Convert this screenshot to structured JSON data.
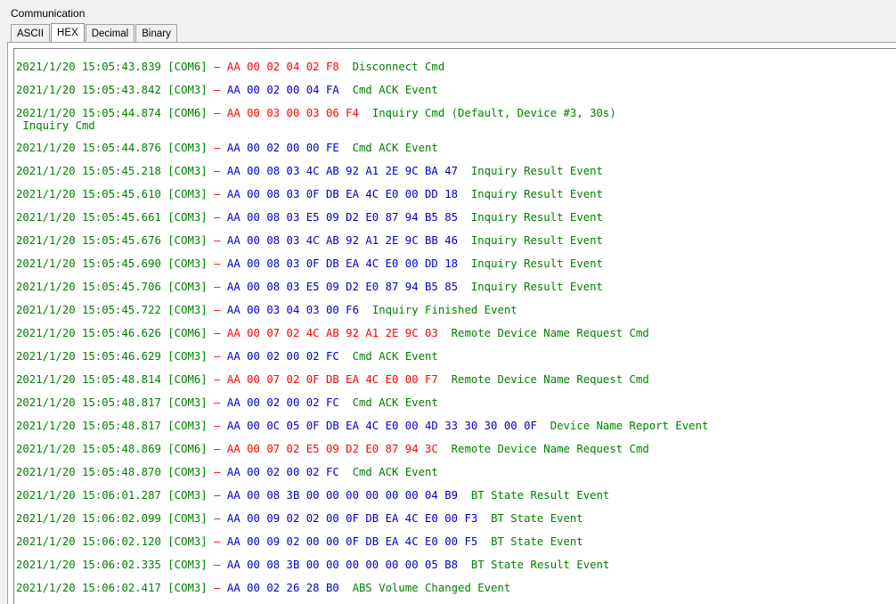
{
  "group_title": "Communication",
  "tabs": [
    {
      "label": "ASCII",
      "active": false
    },
    {
      "label": "HEX",
      "active": true
    },
    {
      "label": "Decimal",
      "active": false
    },
    {
      "label": "Binary",
      "active": false
    }
  ],
  "separator": "–",
  "colors": {
    "timestamp": "#008000",
    "cmd_hex": "#ff0000",
    "event_hex": "#0000c8",
    "description": "#008000"
  },
  "log": [
    {
      "ts": "2021/1/20 15:05:43.839 [COM6]",
      "kind": "cmd",
      "hex": "AA 00 02 04 02 F8",
      "desc": "Disconnect Cmd",
      "cont": ""
    },
    {
      "ts": "2021/1/20 15:05:43.842 [COM3]",
      "kind": "evt",
      "hex": "AA 00 02 00 04 FA",
      "desc": "Cmd ACK Event",
      "cont": ""
    },
    {
      "ts": "2021/1/20 15:05:44.874 [COM6]",
      "kind": "cmd",
      "hex": "AA 00 03 00 03 06 F4",
      "desc": "Inquiry Cmd (Default, Device #3, 30s)",
      "cont": " Inquiry Cmd"
    },
    {
      "ts": "2021/1/20 15:05:44.876 [COM3]",
      "kind": "evt",
      "hex": "AA 00 02 00 00 FE",
      "desc": "Cmd ACK Event",
      "cont": ""
    },
    {
      "ts": "2021/1/20 15:05:45.218 [COM3]",
      "kind": "evt",
      "hex": "AA 00 08 03 4C AB 92 A1 2E 9C BA 47",
      "desc": "Inquiry Result Event",
      "cont": ""
    },
    {
      "ts": "2021/1/20 15:05:45.610 [COM3]",
      "kind": "evt",
      "hex": "AA 00 08 03 0F DB EA 4C E0 00 DD 18",
      "desc": "Inquiry Result Event",
      "cont": ""
    },
    {
      "ts": "2021/1/20 15:05:45.661 [COM3]",
      "kind": "evt",
      "hex": "AA 00 08 03 E5 09 D2 E0 87 94 B5 85",
      "desc": "Inquiry Result Event",
      "cont": ""
    },
    {
      "ts": "2021/1/20 15:05:45.676 [COM3]",
      "kind": "evt",
      "hex": "AA 00 08 03 4C AB 92 A1 2E 9C BB 46",
      "desc": "Inquiry Result Event",
      "cont": ""
    },
    {
      "ts": "2021/1/20 15:05:45.690 [COM3]",
      "kind": "evt",
      "hex": "AA 00 08 03 0F DB EA 4C E0 00 DD 18",
      "desc": "Inquiry Result Event",
      "cont": ""
    },
    {
      "ts": "2021/1/20 15:05:45.706 [COM3]",
      "kind": "evt",
      "hex": "AA 00 08 03 E5 09 D2 E0 87 94 B5 85",
      "desc": "Inquiry Result Event",
      "cont": ""
    },
    {
      "ts": "2021/1/20 15:05:45.722 [COM3]",
      "kind": "evt",
      "hex": "AA 00 03 04 03 00 F6",
      "desc": "Inquiry Finished Event",
      "cont": ""
    },
    {
      "ts": "2021/1/20 15:05:46.626 [COM6]",
      "kind": "cmd",
      "hex": "AA 00 07 02 4C AB 92 A1 2E 9C 03",
      "desc": "Remote Device Name Request Cmd",
      "cont": ""
    },
    {
      "ts": "2021/1/20 15:05:46.629 [COM3]",
      "kind": "evt",
      "hex": "AA 00 02 00 02 FC",
      "desc": "Cmd ACK Event",
      "cont": ""
    },
    {
      "ts": "2021/1/20 15:05:48.814 [COM6]",
      "kind": "cmd",
      "hex": "AA 00 07 02 0F DB EA 4C E0 00 F7",
      "desc": "Remote Device Name Request Cmd",
      "cont": ""
    },
    {
      "ts": "2021/1/20 15:05:48.817 [COM3]",
      "kind": "evt",
      "hex": "AA 00 02 00 02 FC",
      "desc": "Cmd ACK Event",
      "cont": ""
    },
    {
      "ts": "2021/1/20 15:05:48.817 [COM3]",
      "kind": "evt",
      "hex": "AA 00 0C 05 0F DB EA 4C E0 00 4D 33 30 30 00 0F",
      "desc": "Device Name Report Event",
      "cont": ""
    },
    {
      "ts": "2021/1/20 15:05:48.869 [COM6]",
      "kind": "cmd",
      "hex": "AA 00 07 02 E5 09 D2 E0 87 94 3C",
      "desc": "Remote Device Name Request Cmd",
      "cont": ""
    },
    {
      "ts": "2021/1/20 15:05:48.870 [COM3]",
      "kind": "evt",
      "hex": "AA 00 02 00 02 FC",
      "desc": "Cmd ACK Event",
      "cont": ""
    },
    {
      "ts": "2021/1/20 15:06:01.287 [COM3]",
      "kind": "evt",
      "hex": "AA 00 08 3B 00 00 00 00 00 00 04 B9",
      "desc": "BT State Result Event",
      "cont": ""
    },
    {
      "ts": "2021/1/20 15:06:02.099 [COM3]",
      "kind": "evt",
      "hex": "AA 00 09 02 02 00 0F DB EA 4C E0 00 F3",
      "desc": "BT State Event",
      "cont": ""
    },
    {
      "ts": "2021/1/20 15:06:02.120 [COM3]",
      "kind": "evt",
      "hex": "AA 00 09 02 00 00 0F DB EA 4C E0 00 F5",
      "desc": "BT State Event",
      "cont": ""
    },
    {
      "ts": "2021/1/20 15:06:02.335 [COM3]",
      "kind": "evt",
      "hex": "AA 00 08 3B 00 00 00 00 00 00 05 B8",
      "desc": "BT State Result Event",
      "cont": ""
    },
    {
      "ts": "2021/1/20 15:06:02.417 [COM3]",
      "kind": "evt",
      "hex": "AA 00 02 26 28 B0",
      "desc": "ABS Volume Changed Event",
      "cont": ""
    }
  ]
}
